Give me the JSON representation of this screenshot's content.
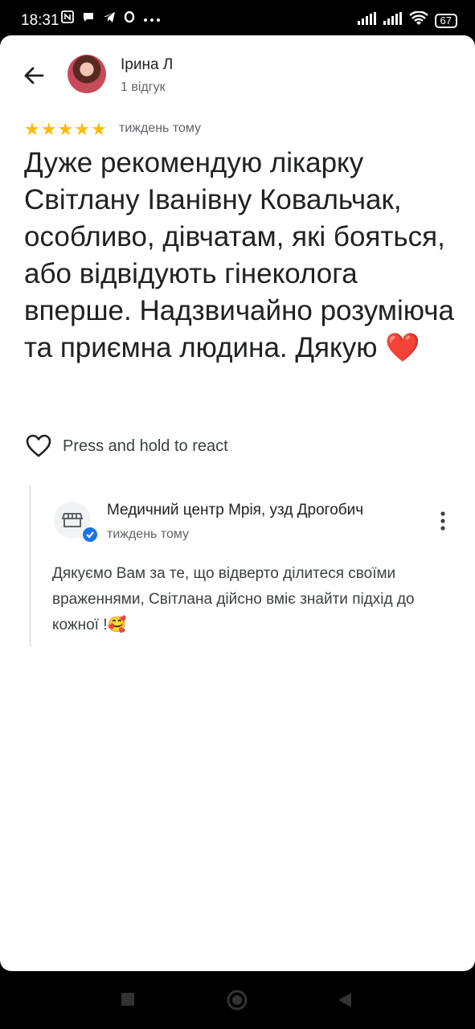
{
  "status_bar": {
    "time": "18:31",
    "battery": "67",
    "icons": [
      "nfc-icon",
      "chat-icon",
      "telegram-icon",
      "opera-icon",
      "more-dots-icon",
      "signal-icon",
      "signal-icon",
      "wifi-icon",
      "battery-icon"
    ]
  },
  "header": {
    "author": "Ірина Л",
    "reviews_count": "1 відгук"
  },
  "review": {
    "rating": 5,
    "time": "тиждень тому",
    "text": "Дуже рекомендую лікарку Світлану Іванівну Ковальчак, особливо, дівчатам, які бояться, або відвідують гінеколога вперше. Надзвичайно розуміюча та приємна людина. Дякую ❤️"
  },
  "react": {
    "label": "Press and hold to react"
  },
  "owner_reply": {
    "name": "Медичний центр Мрія, узд Дрогобич",
    "time": "тиждень тому",
    "text": "Дякуємо Вам за те, що відверто ділитеся своїми враженнями, Світлана дійсно вміє знайти підхід до кожної !🥰"
  },
  "colors": {
    "star": "#fbbc04",
    "verified": "#1a73e8",
    "heart": "#e53935"
  }
}
